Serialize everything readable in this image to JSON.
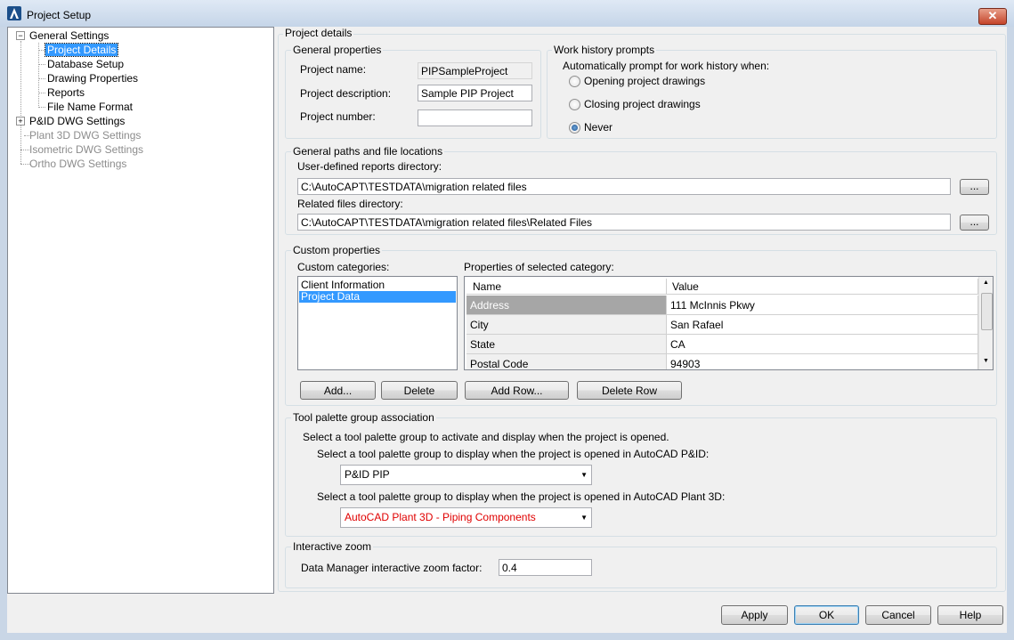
{
  "window": {
    "title": "Project Setup",
    "close_glyph": "✕",
    "accent": "#3399ff"
  },
  "tree": {
    "items": [
      {
        "label": "General Settings",
        "state": "expanded"
      },
      {
        "label": "Project Details",
        "state": "selected"
      },
      {
        "label": "Database Setup"
      },
      {
        "label": "Drawing Properties"
      },
      {
        "label": "Reports"
      },
      {
        "label": "File Name Format"
      },
      {
        "label": "P&ID DWG Settings",
        "state": "collapsed"
      },
      {
        "label": "Plant 3D DWG Settings",
        "state": "disabled"
      },
      {
        "label": "Isometric DWG Settings",
        "state": "disabled"
      },
      {
        "label": "Ortho DWG Settings",
        "state": "disabled"
      }
    ],
    "expand_glyph": "−",
    "collapse_glyph": "+"
  },
  "panel_title": "Project details",
  "general_properties": {
    "title": "General properties",
    "name_label": "Project name:",
    "name_value": "PIPSampleProject",
    "description_label": "Project description:",
    "description_value": "Sample PIP Project",
    "number_label": "Project number:",
    "number_value": ""
  },
  "work_history": {
    "title": "Work history prompts",
    "prompt": "Automatically prompt for work history when:",
    "options": [
      {
        "label": "Opening project drawings",
        "checked": false
      },
      {
        "label": "Closing project drawings",
        "checked": false
      },
      {
        "label": "Never",
        "checked": true
      }
    ]
  },
  "paths": {
    "title": "General paths and file locations",
    "reports_label": "User-defined reports directory:",
    "reports_value": "C:\\AutoCAPT\\TESTDATA\\migration related files",
    "related_label": "Related files directory:",
    "related_value": "C:\\AutoCAPT\\TESTDATA\\migration related files\\Related Files",
    "browse_label": "..."
  },
  "custom": {
    "title": "Custom properties",
    "categories_label": "Custom categories:",
    "categories": [
      "Client Information",
      "Project Data"
    ],
    "properties_label": "Properties of selected category:",
    "columns": [
      "Name",
      "Value"
    ],
    "rows": [
      {
        "name": "Address",
        "value": "111 McInnis Pkwy"
      },
      {
        "name": "City",
        "value": "San Rafael"
      },
      {
        "name": "State",
        "value": "CA"
      },
      {
        "name": "Postal Code",
        "value": "94903"
      }
    ],
    "add_label": "Add...",
    "delete_label": "Delete",
    "add_row_label": "Add Row...",
    "delete_row_label": "Delete Row",
    "scroll_up_glyph": "▲",
    "scroll_down_glyph": "▼"
  },
  "tool_palette": {
    "title": "Tool palette group association",
    "intro": "Select a tool palette group to activate and display when the project is opened.",
    "pid_label": "Select a tool palette group to display when the project is opened in AutoCAD P&ID:",
    "pid_value": "P&ID PIP",
    "plant_label": "Select a tool palette group to display when the project is opened in AutoCAD Plant 3D:",
    "plant_value": "AutoCAD Plant 3D - Piping Components",
    "plant_value_color": "#e00000",
    "dropdown_glyph": "▼"
  },
  "zoom": {
    "title": "Interactive zoom",
    "label": "Data Manager interactive zoom factor:",
    "value": "0.4"
  },
  "footer": {
    "apply": "Apply",
    "ok": "OK",
    "cancel": "Cancel",
    "help": "Help"
  }
}
